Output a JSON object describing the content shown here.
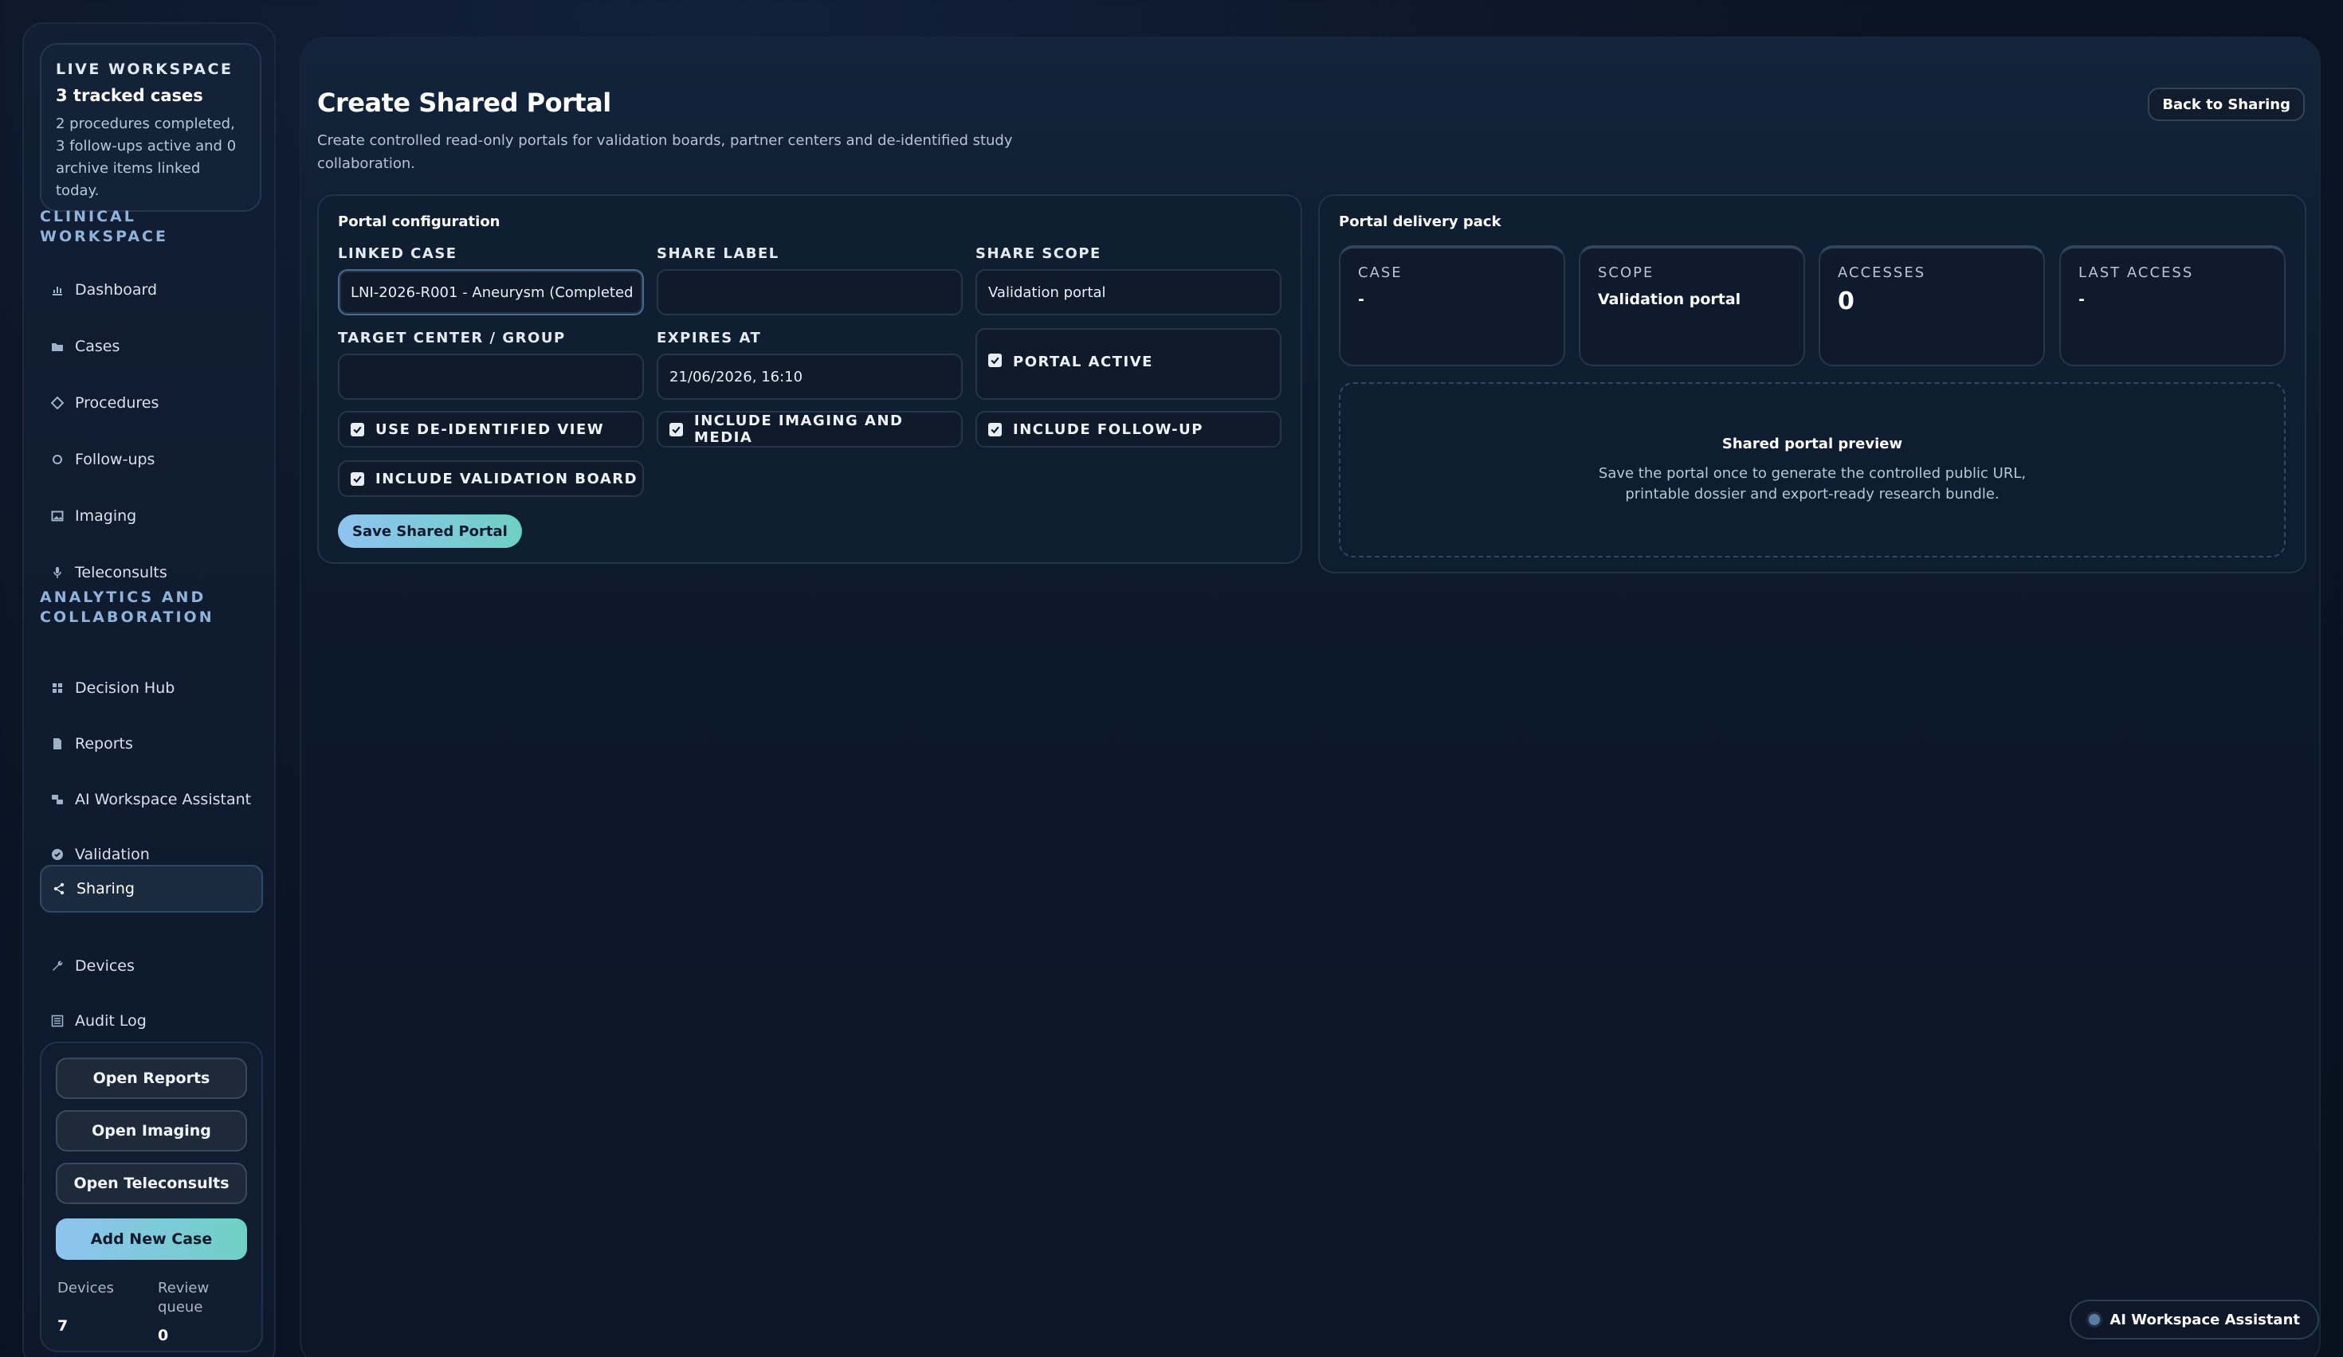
{
  "sidebar": {
    "live": {
      "eyebrow": "LIVE WORKSPACE",
      "title": "3 tracked cases",
      "description": "2 procedures completed, 3 follow-ups active and 0 archive items linked today."
    },
    "sections": {
      "clinical": "CLINICAL WORKSPACE",
      "analytics": "ANALYTICS AND COLLABORATION"
    },
    "clinical_items": [
      {
        "label": "Dashboard",
        "icon": "chart-icon"
      },
      {
        "label": "Cases",
        "icon": "folder-icon"
      },
      {
        "label": "Procedures",
        "icon": "diamond-icon"
      },
      {
        "label": "Follow-ups",
        "icon": "cycle-icon"
      },
      {
        "label": "Imaging",
        "icon": "image-icon"
      },
      {
        "label": "Teleconsults",
        "icon": "microphone-icon"
      }
    ],
    "analytics_items": [
      {
        "label": "Decision Hub",
        "icon": "grid-icon"
      },
      {
        "label": "Reports",
        "icon": "document-icon"
      },
      {
        "label": "AI Workspace Assistant",
        "icon": "robot-icon"
      },
      {
        "label": "Validation",
        "icon": "check-circle-icon"
      },
      {
        "label": "Sharing",
        "icon": "share-icon",
        "active": true
      },
      {
        "label": "Devices",
        "icon": "wrench-icon"
      },
      {
        "label": "Audit Log",
        "icon": "list-icon"
      }
    ],
    "actions": {
      "open_reports": "Open Reports",
      "open_imaging": "Open Imaging",
      "open_teleconsults": "Open Teleconsults",
      "add_new_case": "Add New Case"
    },
    "stats": {
      "devices_label": "Devices",
      "devices_value": "7",
      "review_label": "Review queue",
      "review_value": "0"
    }
  },
  "header": {
    "title": "Create Shared Portal",
    "description": "Create controlled read-only portals for validation boards, partner centers and de-identified study collaboration.",
    "back_label": "Back to Sharing"
  },
  "config": {
    "title": "Portal configuration",
    "linked_case_label": "LINKED CASE",
    "linked_case_value": "LNI-2026-R001 - Aneurysm (Completed",
    "share_label_label": "SHARE LABEL",
    "share_label_value": "",
    "share_scope_label": "SHARE SCOPE",
    "share_scope_value": "Validation portal",
    "target_label": "TARGET CENTER / GROUP",
    "target_value": "",
    "expires_label": "EXPIRES AT",
    "expires_value": "21/06/2026, 16:10",
    "checks": {
      "portal_active": "PORTAL ACTIVE",
      "deidentified": "USE DE-IDENTIFIED VIEW",
      "imaging": "INCLUDE IMAGING AND MEDIA",
      "followup": "INCLUDE FOLLOW-UP",
      "validation_board": "INCLUDE VALIDATION BOARD"
    },
    "save_label": "Save Shared Portal"
  },
  "delivery": {
    "title": "Portal delivery pack",
    "metrics": {
      "case_label": "CASE",
      "case_value": "-",
      "scope_label": "SCOPE",
      "scope_value": "Validation portal",
      "accesses_label": "ACCESSES",
      "accesses_value": "0",
      "last_access_label": "LAST ACCESS",
      "last_access_value": "-"
    },
    "preview_title": "Shared portal preview",
    "preview_description": "Save the portal once to generate the controlled public URL, printable dossier and export-ready research bundle."
  },
  "assistant_label": "AI Workspace Assistant",
  "colors": {
    "accent_start": "#8ec3f0",
    "accent_end": "#6ed0c4",
    "background": "#0b1525"
  }
}
